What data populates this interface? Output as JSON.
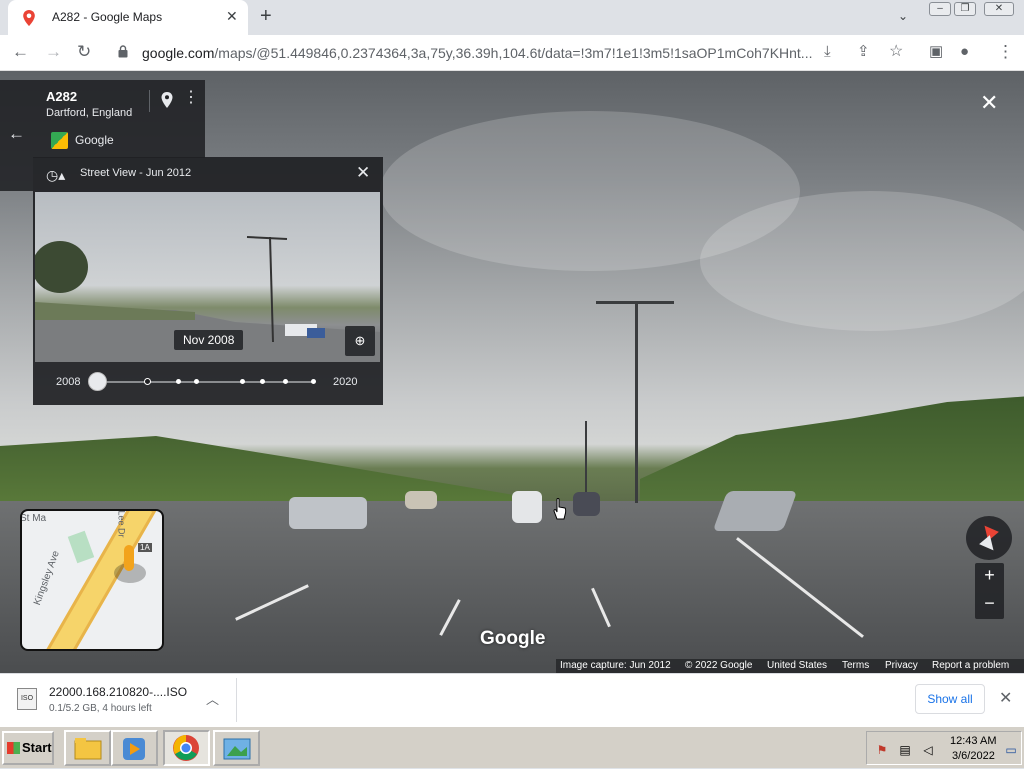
{
  "browser": {
    "tab_title": "A282 - Google Maps",
    "tab_close": "✕",
    "new_tab": "+",
    "url_host": "google.com",
    "url_rest": "/maps/@51.449846,0.2374364,3a,75y,36.39h,104.6t/data=!3m7!1e1!3m5!1saOP1mCoh7KHnt...",
    "window_controls": [
      "minimize",
      "restore",
      "close"
    ]
  },
  "place_card": {
    "title": "A282",
    "subtitle": "Dartford, England",
    "provider": "Google"
  },
  "time_travel": {
    "header": "Street View - Jun 2012",
    "thumbnail_date": "Nov 2008",
    "start_year": "2008",
    "end_year": "2020",
    "selected_index": 0
  },
  "minimap": {
    "labels": [
      "Kingsley Ave",
      "Lee Dr",
      "St Ma"
    ],
    "badge": "1A"
  },
  "watermark": "Google",
  "footer": {
    "capture": "Image capture: Jun 2012",
    "copyright": "© 2022 Google",
    "country": "United States",
    "terms": "Terms",
    "privacy": "Privacy",
    "report": "Report a problem"
  },
  "download": {
    "file_name": "22000.168.210820-....ISO",
    "status": "0.1/5.2 GB, 4 hours left",
    "show_all": "Show all",
    "icon_label": "ISO"
  },
  "taskbar": {
    "start": "Start",
    "apps": [
      "file-explorer",
      "media-player",
      "chrome",
      "image-viewer"
    ],
    "time": "12:43 AM",
    "date": "3/6/2022"
  },
  "colors": {
    "accent": "#1a73e8",
    "panel": "#202124",
    "compass_north": "#ea4335"
  }
}
